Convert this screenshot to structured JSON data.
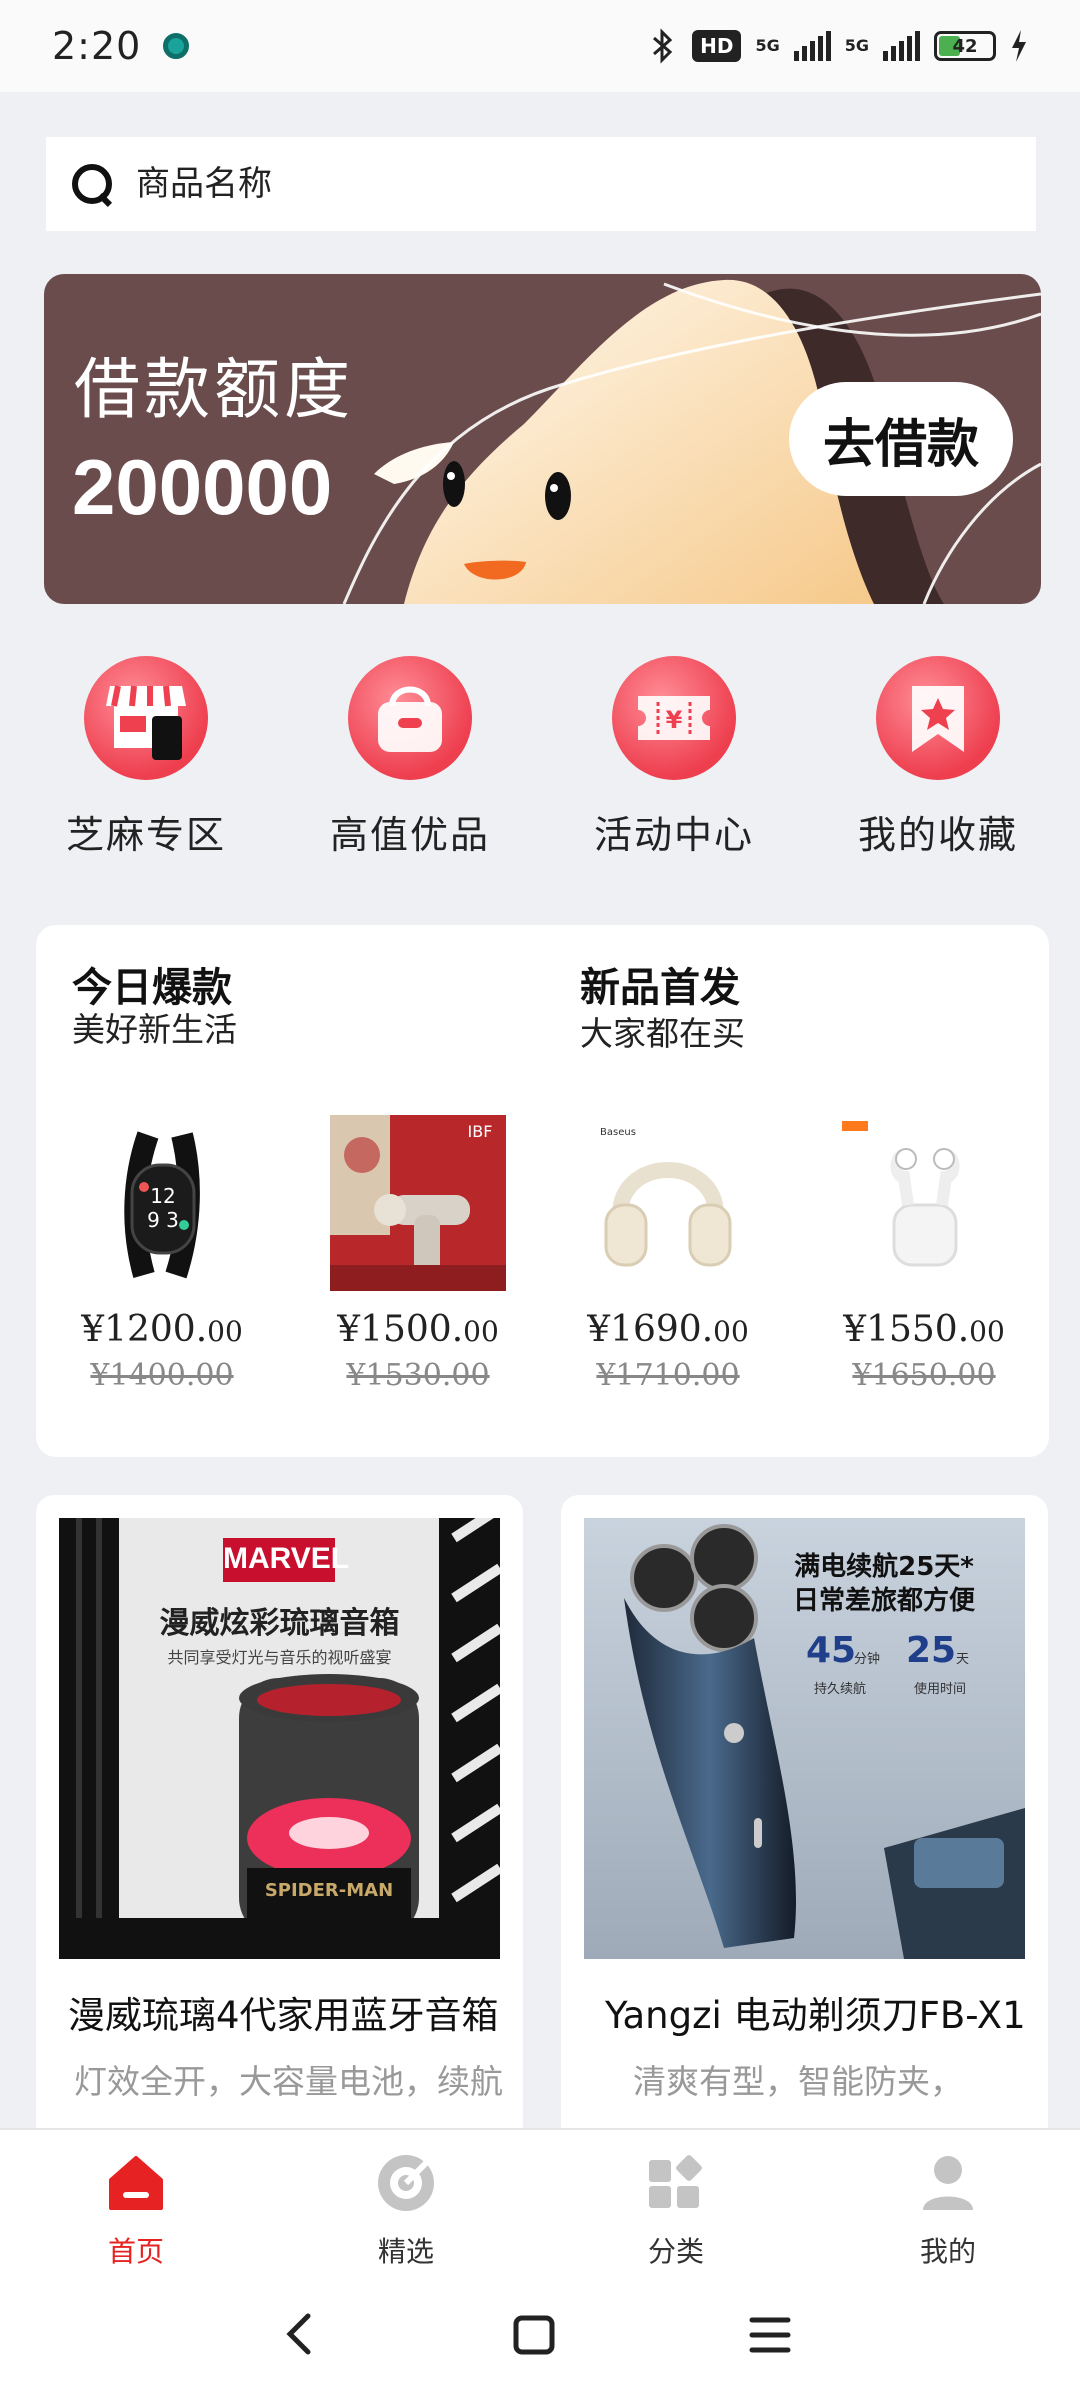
{
  "status_bar": {
    "time": "2:20",
    "hd": "HD",
    "net1": "5G",
    "net2": "5G",
    "battery": "42"
  },
  "search": {
    "placeholder": "商品名称"
  },
  "banner": {
    "title": "借款额度",
    "amount": "200000",
    "button": "去借款",
    "bg_color": "#6b4c4c"
  },
  "quick_entries": [
    {
      "label": "芝麻专区",
      "icon": "shop-icon"
    },
    {
      "label": "高值优品",
      "icon": "bag-icon"
    },
    {
      "label": "活动中心",
      "icon": "ticket-icon"
    },
    {
      "label": "我的收藏",
      "icon": "star-bookmark-icon"
    }
  ],
  "hot": {
    "left_title": "今日爆款",
    "left_sub": "美好新生活",
    "right_title": "新品首发",
    "right_sub": "大家都在买",
    "products": [
      {
        "price": "¥1200.",
        "cents": "00",
        "original": "¥1400.00",
        "image": "smart-band"
      },
      {
        "price": "¥1500.",
        "cents": "00",
        "original": "¥1530.00",
        "image": "massage-gun"
      },
      {
        "price": "¥1690.",
        "cents": "00",
        "original": "¥1710.00",
        "image": "headphones"
      },
      {
        "price": "¥1550.",
        "cents": "00",
        "original": "¥1650.00",
        "image": "earbuds"
      }
    ]
  },
  "cards": [
    {
      "title": "漫威琉璃4代家用蓝牙音箱",
      "desc": "灯效全开，大容量电池，续航持久",
      "img_brand": "MARVEL",
      "img_headline": "漫威炫彩琉璃音箱",
      "img_sub": "共同享受灯光与音乐的视听盛宴",
      "img_base": "SPIDER-MAN"
    },
    {
      "title": "Yangzi 电动剃须刀FB-X1",
      "desc": "清爽有型，智能防夹，",
      "img_line1": "满电续航25天*",
      "img_line2": "日常差旅都方便",
      "stat1_value": "45",
      "stat1_unit": "分钟",
      "stat1_label": "持久续航",
      "stat2_value": "25",
      "stat2_unit": "天",
      "stat2_label": "使用时间"
    }
  ],
  "tabbar": [
    {
      "label": "首页",
      "icon": "home-icon",
      "active": true
    },
    {
      "label": "精选",
      "icon": "target-icon",
      "active": false
    },
    {
      "label": "分类",
      "icon": "grid-icon",
      "active": false
    },
    {
      "label": "我的",
      "icon": "user-icon",
      "active": false
    }
  ],
  "colors": {
    "accent": "#e62222",
    "page_bg": "#eef0f4"
  }
}
